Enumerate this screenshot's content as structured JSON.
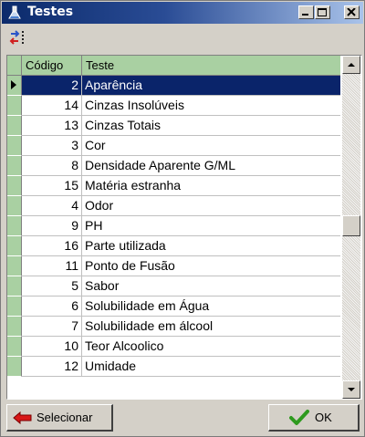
{
  "window": {
    "title": "Testes"
  },
  "titlebar_buttons": [
    "minimize",
    "maximize",
    "close"
  ],
  "toolbar": {
    "icon": "sort-icon"
  },
  "grid": {
    "columns": [
      "Código",
      "Teste"
    ],
    "rows": [
      {
        "code": "2",
        "name": "Aparência",
        "selected": true
      },
      {
        "code": "14",
        "name": "Cinzas Insolúveis"
      },
      {
        "code": "13",
        "name": "Cinzas Totais"
      },
      {
        "code": "3",
        "name": "Cor"
      },
      {
        "code": "8",
        "name": "Densidade Aparente G/ML"
      },
      {
        "code": "15",
        "name": "Matéria estranha"
      },
      {
        "code": "4",
        "name": "Odor"
      },
      {
        "code": "9",
        "name": "PH"
      },
      {
        "code": "16",
        "name": "Parte utilizada"
      },
      {
        "code": "11",
        "name": "Ponto de Fusão"
      },
      {
        "code": "5",
        "name": "Sabor"
      },
      {
        "code": "6",
        "name": "Solubilidade em Água"
      },
      {
        "code": "7",
        "name": "Solubilidade em álcool"
      },
      {
        "code": "10",
        "name": "Teor Alcoolico"
      },
      {
        "code": "12",
        "name": "Umidade"
      }
    ]
  },
  "buttons": {
    "select_label": "Selecionar",
    "ok_label": "OK"
  },
  "colors": {
    "selection": "#0a246a",
    "header_green": "#a9d0a2",
    "title_gradient_start": "#0b2a6b"
  }
}
